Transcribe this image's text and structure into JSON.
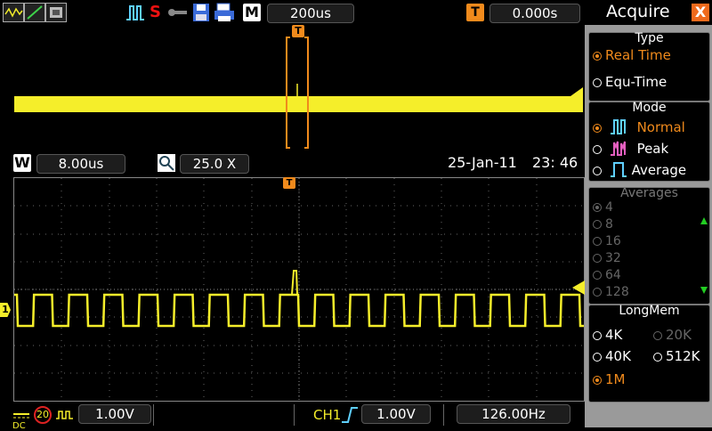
{
  "toolbar": {
    "timebase": "200us",
    "m_label": "M",
    "trigger_label": "T",
    "trigger_delay": "0.000s",
    "stop_label": "S"
  },
  "window": {
    "w_label": "W",
    "timebase": "8.00us",
    "zoom": "25.0  X",
    "date": "25-Jan-11",
    "time": "23: 46"
  },
  "bottom": {
    "coupling": "DC",
    "bw_limit": "20",
    "ch_scale": "1.00V",
    "trig_source": "CH1",
    "trig_level": "1.00V",
    "frequency": "126.00Hz",
    "channel_marker": "1"
  },
  "menu": {
    "title": "Acquire",
    "close": "X",
    "type": {
      "title": "Type",
      "options": [
        "Real  Time",
        "Equ-Time"
      ]
    },
    "mode": {
      "title": "Mode",
      "options": [
        "Normal",
        "Peak",
        "Average"
      ]
    },
    "averages": {
      "title": "Averages",
      "options": [
        "4",
        "8",
        "16",
        "32",
        "64",
        "128"
      ]
    },
    "longmem": {
      "title": "LongMem",
      "options": [
        "4K",
        "20K",
        "40K",
        "512K",
        "1M"
      ]
    }
  },
  "colors": {
    "trace": "#f5ee2a",
    "accent": "#f08a1c",
    "panel": "#9a9a9a"
  }
}
